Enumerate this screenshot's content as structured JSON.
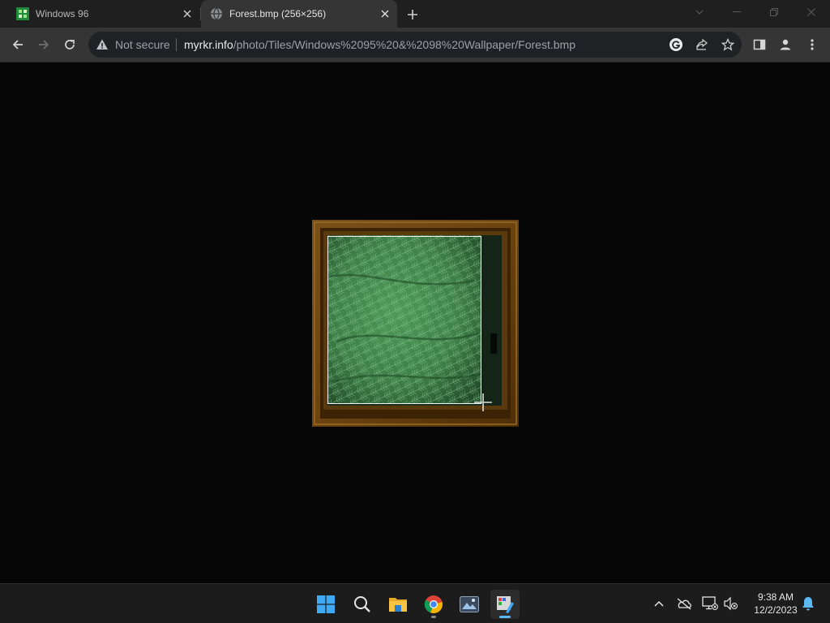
{
  "browser": {
    "tabs": [
      {
        "title": "Windows 96",
        "favicon": "windows96-favicon",
        "active": false
      },
      {
        "title": "Forest.bmp (256×256)",
        "favicon": "globe-icon",
        "active": true
      }
    ],
    "security_label": "Not secure",
    "url_host": "myrkr.info",
    "url_path": "/photo/Tiles/Windows%2095%20&%2098%20Wallpaper/Forest.bmp"
  },
  "image": {
    "file_name": "Forest.bmp",
    "frame_color": "#6b4310",
    "foliage_color": "#3f8048"
  },
  "taskbar": {
    "apps": [
      "start-icon",
      "search-icon",
      "file-explorer-icon",
      "chrome-icon",
      "photos-icon",
      "paint-icon"
    ],
    "clock_time": "9:38 AM",
    "clock_date": "12/2/2023",
    "accent_color": "#5bb8f5"
  }
}
